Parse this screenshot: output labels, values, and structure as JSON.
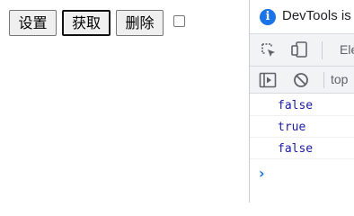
{
  "page": {
    "buttons": [
      {
        "label": "设置"
      },
      {
        "label": "获取"
      },
      {
        "label": "删除"
      }
    ],
    "checkbox": {
      "checked": false
    }
  },
  "devtools": {
    "info_text": "DevTools is n",
    "tabs": {
      "elements_label": "Ele"
    },
    "console": {
      "context": "top",
      "logs": [
        "false",
        "true",
        "false"
      ],
      "prompt_symbol": "›"
    },
    "colors": {
      "accent": "#1a73e8",
      "log_value": "#1a1aa6",
      "toolbar_bg": "#f1f3f4"
    }
  }
}
